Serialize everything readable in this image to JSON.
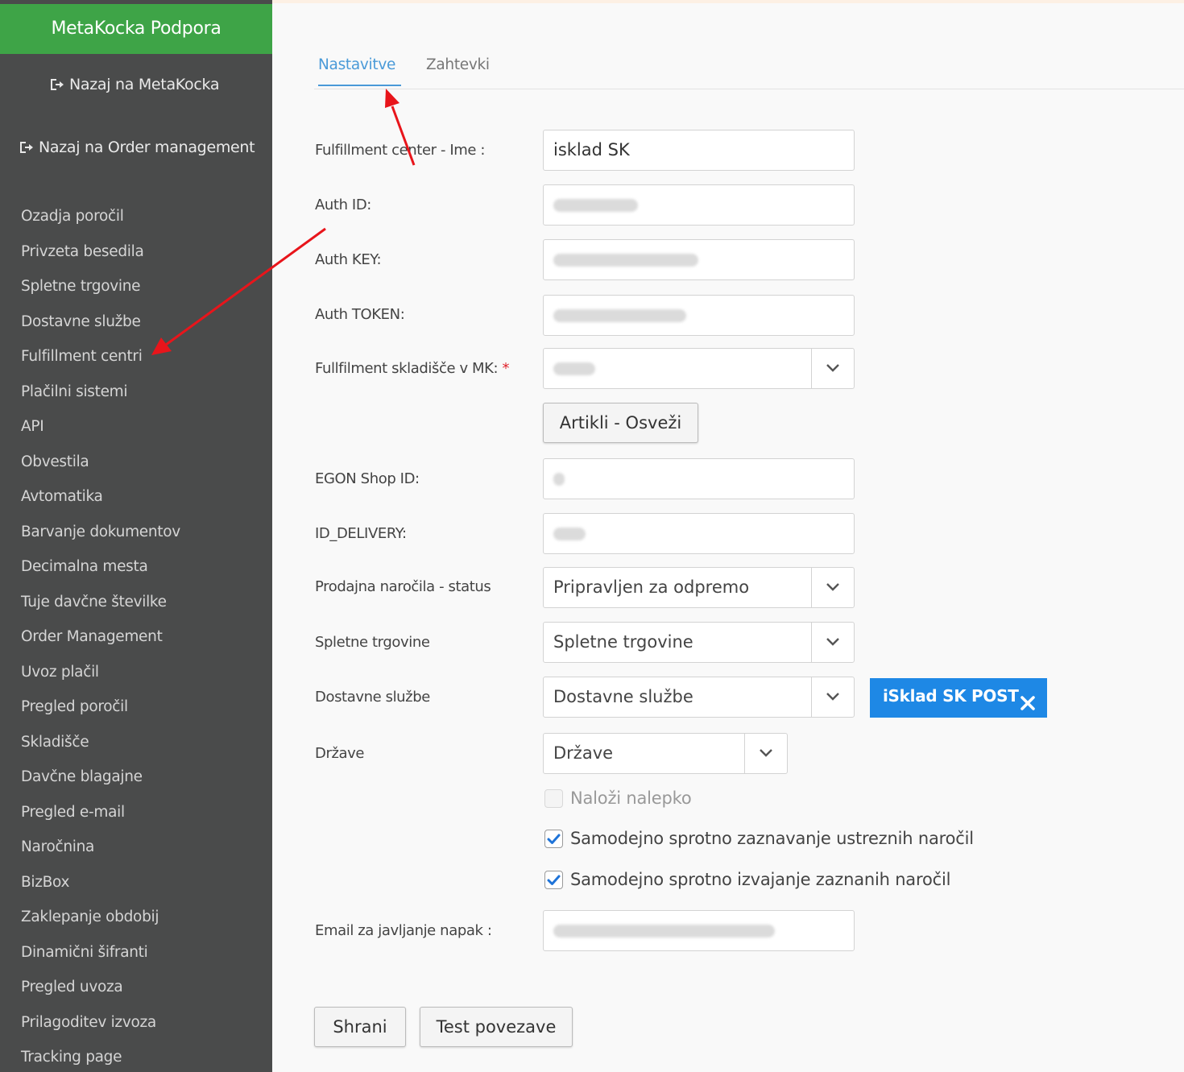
{
  "sidebar": {
    "brand": "MetaKocka Podpora",
    "back_links": [
      {
        "label": "Nazaj na MetaKocka",
        "icon": "sign-out-icon"
      },
      {
        "label": "Nazaj na Order management",
        "icon": "sign-out-icon"
      }
    ],
    "items": [
      "Ozadja poročil",
      "Privzeta besedila",
      "Spletne trgovine",
      "Dostavne službe",
      "Fulfillment centri",
      "Plačilni sistemi",
      "API",
      "Obvestila",
      "Avtomatika",
      "Barvanje dokumentov",
      "Decimalna mesta",
      "Tuje davčne številke",
      "Order Management",
      "Uvoz plačil",
      "Pregled poročil",
      "Skladišče",
      "Davčne blagajne",
      "Pregled e-mail",
      "Naročnina",
      "BizBox",
      "Zaklepanje obdobij",
      "Dinamični šifranti",
      "Pregled uvoza",
      "Prilagoditev izvoza",
      "Tracking page"
    ]
  },
  "tabs": {
    "settings": "Nastavitve",
    "requests": "Zahtevki",
    "active": "Nastavitve"
  },
  "form": {
    "name_label": "Fulfillment center - Ime :",
    "name_value": "isklad SK",
    "auth_id_label": "Auth ID:",
    "auth_key_label": "Auth KEY:",
    "auth_token_label": "Auth TOKEN:",
    "warehouse_label": "Fullfilment skladišče v MK:",
    "warehouse_required": "*",
    "refresh_button": "Artikli - Osveži",
    "egon_shop_label": "EGON Shop ID:",
    "id_delivery_label": "ID_DELIVERY:",
    "order_status_label": "Prodajna naročila - status",
    "order_status_value": "Pripravljen za odpremo",
    "webshops_label": "Spletne trgovine",
    "webshops_placeholder": "Spletne trgovine",
    "delivery_label": "Dostavne službe",
    "delivery_placeholder": "Dostavne službe",
    "delivery_tag": "iSklad SK POST",
    "countries_label": "Države",
    "countries_placeholder": "Države",
    "checkbox_label_label": "Naloži nalepko",
    "checkbox_label_checked": false,
    "checkbox_auto_detect_label": "Samodejno sprotno zaznavanje ustreznih naročil",
    "checkbox_auto_detect_checked": true,
    "checkbox_auto_execute_label": "Samodejno sprotno izvajanje zaznanih naročil",
    "checkbox_auto_execute_checked": true,
    "email_label": "Email za javljanje napak :"
  },
  "actions": {
    "save": "Shrani",
    "test": "Test povezave"
  },
  "colors": {
    "brand": "#3ea447",
    "sidebar": "#4a4b4b",
    "accent": "#4a9ad8",
    "tag": "#1e88e5",
    "annotation_arrow": "#e8151b"
  }
}
